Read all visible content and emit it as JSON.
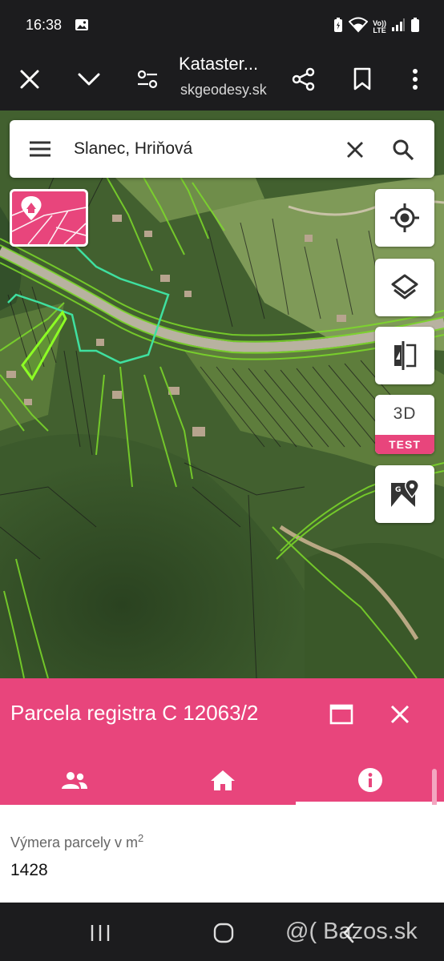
{
  "status_bar": {
    "time": "16:38",
    "icons": [
      "image-icon",
      "battery-saver-icon",
      "wifi-icon",
      "volte-icon",
      "signal-icon",
      "battery-icon"
    ],
    "volte_text_top": "Vo))",
    "volte_text_bottom": "LTE"
  },
  "browser": {
    "page_title": "Kataster...",
    "page_url": "skgeodesy.sk",
    "buttons": [
      "close-icon",
      "chevron-down-icon",
      "tune-icon",
      "share-icon",
      "bookmark-icon",
      "more-vertical-icon"
    ]
  },
  "map": {
    "search": {
      "query": "Slanec, Hriňová"
    },
    "buttons": {
      "locate": "my-location-icon",
      "layers": "layers-icon",
      "compare": "compare-icon",
      "three_d_label": "3D",
      "three_d_badge": "TEST",
      "google_maps": "google-maps-icon"
    }
  },
  "parcel": {
    "title": "Parcela registra C 12063/2",
    "tabs": [
      {
        "icon": "people-icon",
        "active": false
      },
      {
        "icon": "home-icon",
        "active": false
      },
      {
        "icon": "info-icon",
        "active": true
      }
    ],
    "area_label": "Výmera parcely v m",
    "area_label_sup": "2",
    "area_value": "1428"
  },
  "nav_bar": {
    "watermark": "@( Bazos.sk"
  },
  "colors": {
    "accent": "#e8457c",
    "bars": "#1c1c1e",
    "parcel_lines": "#7ddb2a"
  }
}
